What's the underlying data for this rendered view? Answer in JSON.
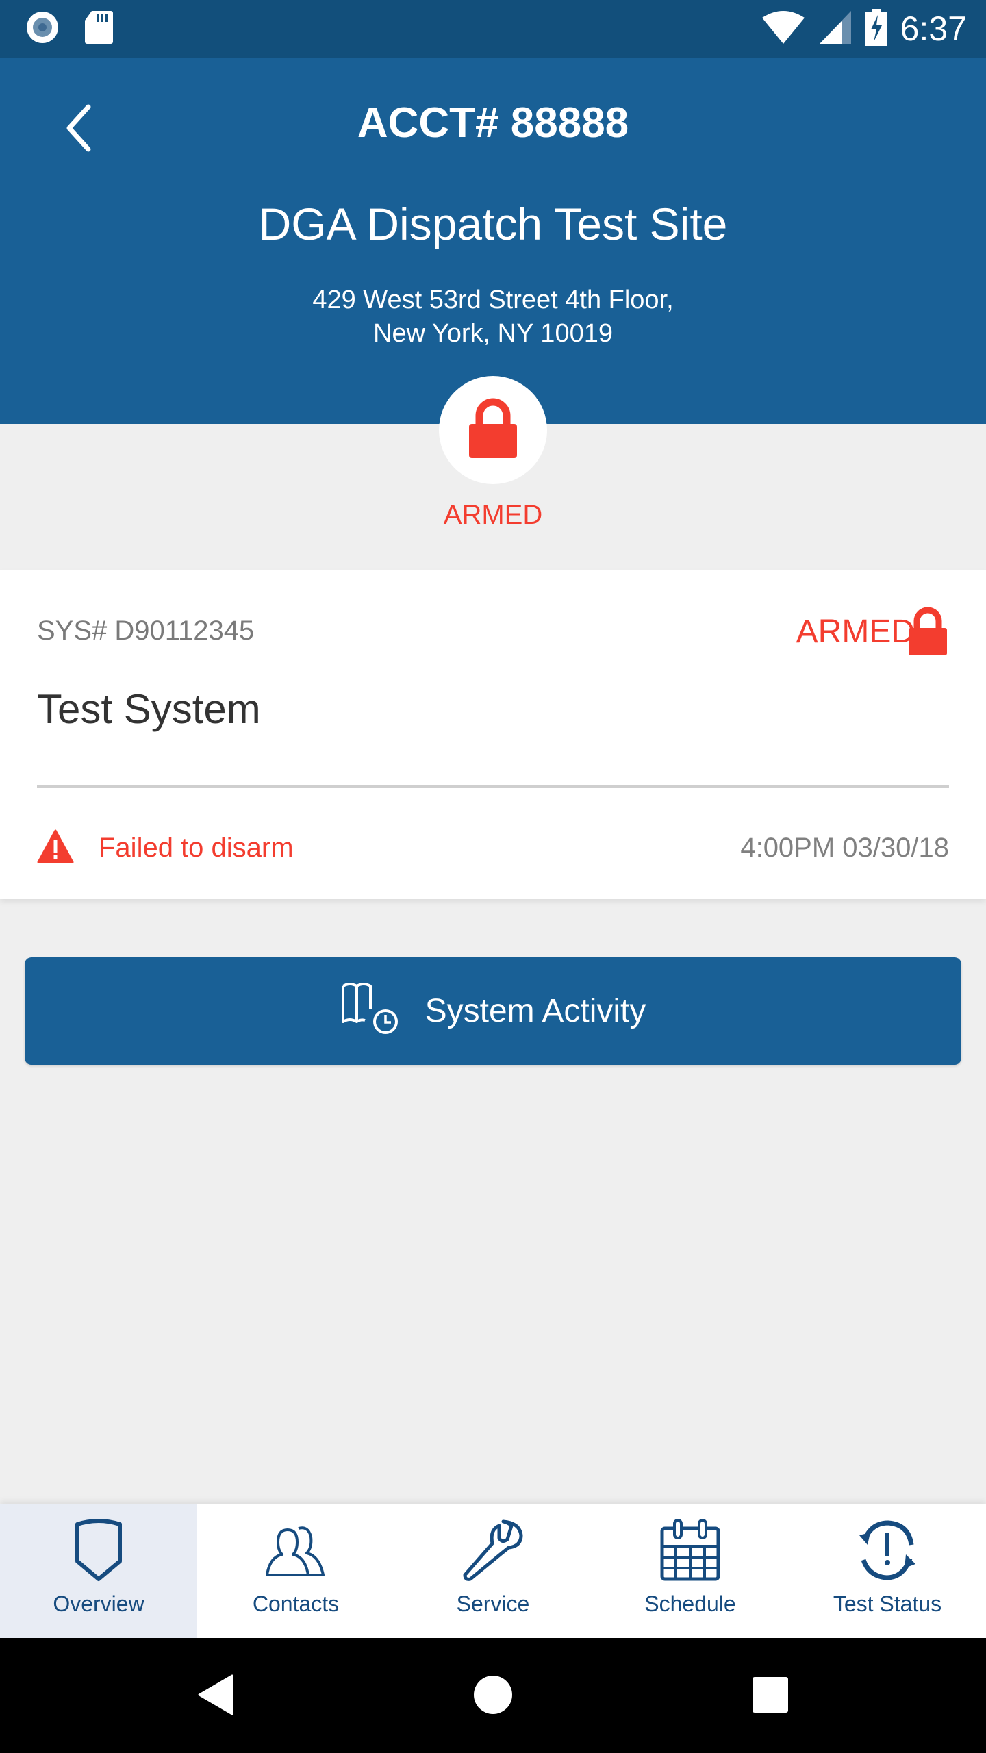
{
  "status_bar": {
    "time": "6:37",
    "left_icons": [
      "record-icon",
      "sd-card-icon"
    ],
    "right_icons": [
      "wifi-icon",
      "cell-signal-icon",
      "battery-charging-icon"
    ]
  },
  "header": {
    "back_icon": "chevron-left-icon",
    "account_title": "ACCT# 88888",
    "site_name": "DGA Dispatch Test Site",
    "address_line1": "429 West 53rd Street 4th Floor,",
    "address_line2": "New York, NY 10019"
  },
  "site_status": {
    "icon": "lock-icon",
    "label": "ARMED"
  },
  "system_card": {
    "system_number": "SYS# D90112345",
    "status_label": "ARMED",
    "status_icon": "lock-icon",
    "system_name": "Test System",
    "alert": {
      "icon": "warning-icon",
      "text": "Failed to disarm",
      "timestamp": "4:00PM 03/30/18"
    }
  },
  "activity_button": {
    "icon": "book-clock-icon",
    "label": "System Activity"
  },
  "bottom_nav": {
    "items": [
      {
        "label": "Overview",
        "icon": "shield-icon",
        "active": true
      },
      {
        "label": "Contacts",
        "icon": "contacts-icon",
        "active": false
      },
      {
        "label": "Service",
        "icon": "wrench-icon",
        "active": false
      },
      {
        "label": "Schedule",
        "icon": "calendar-icon",
        "active": false
      },
      {
        "label": "Test Status",
        "icon": "test-status-icon",
        "active": false
      }
    ]
  },
  "android_nav": {
    "buttons": [
      "back-triangle-icon",
      "home-circle-icon",
      "recents-square-icon"
    ]
  },
  "colors": {
    "status_bar": "#124f7b",
    "header": "#196096",
    "armed_red": "#f33d2f",
    "nav_text": "#164b7f",
    "background": "#efefef"
  }
}
